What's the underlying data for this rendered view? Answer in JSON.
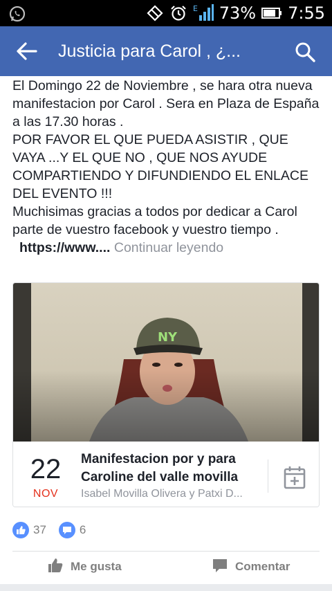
{
  "status_bar": {
    "battery_percent": "73%",
    "time": "7:55",
    "network_label": "E",
    "icons": [
      "whatsapp-icon",
      "data-saver-icon",
      "alarm-icon",
      "signal-icon",
      "battery-icon"
    ]
  },
  "app_bar": {
    "title": "Justicia para Carol , ¿...",
    "background": "#4267b2"
  },
  "post": {
    "paragraph_1": "El Domingo 22 de Noviembre , se hara otra nueva manifestacion por Carol . Sera en Plaza de España a las 17.30 horas .",
    "paragraph_2": "POR FAVOR EL QUE PUEDA ASISTIR , QUE VAYA ...Y EL QUE NO , QUE NOS AYUDE COMPARTIENDO Y DIFUNDIENDO EL ENLACE DEL EVENTO !!!",
    "paragraph_3": "Muchisimas gracias a todos por dedicar a Carol parte de vuestro facebook y vuestro tiempo .",
    "link_text": "https://www....",
    "continue_label": "Continuar leyendo"
  },
  "event": {
    "day": "22",
    "month": "NOV",
    "title": "Manifestacion por y para Caroline del valle movilla",
    "hosts": "Isabel Movilla Olivera y Patxi D..."
  },
  "reactions": {
    "likes": "37",
    "comments": "6"
  },
  "actions": {
    "like_label": "Me gusta",
    "comment_label": "Comentar"
  }
}
